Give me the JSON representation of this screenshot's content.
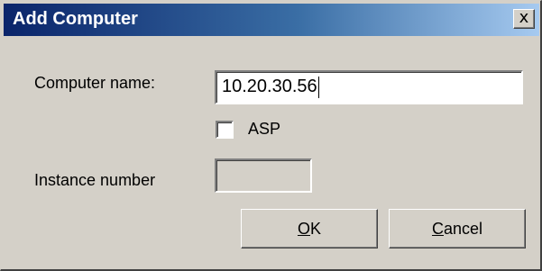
{
  "window": {
    "title": "Add Computer",
    "close_glyph": "x"
  },
  "form": {
    "computer_name_label": "Computer name:",
    "computer_name_value": "10.20.30.56",
    "asp_label": "ASP",
    "asp_checked": false,
    "instance_number_label": "Instance number",
    "instance_number_value": ""
  },
  "buttons": {
    "ok": {
      "mnemonic": "O",
      "rest": "K"
    },
    "cancel": {
      "mnemonic": "C",
      "rest": "ancel"
    }
  },
  "colors": {
    "titlebar_start": "#0a246a",
    "titlebar_end": "#a6caf0",
    "dialog_bg": "#d4d0c8"
  }
}
